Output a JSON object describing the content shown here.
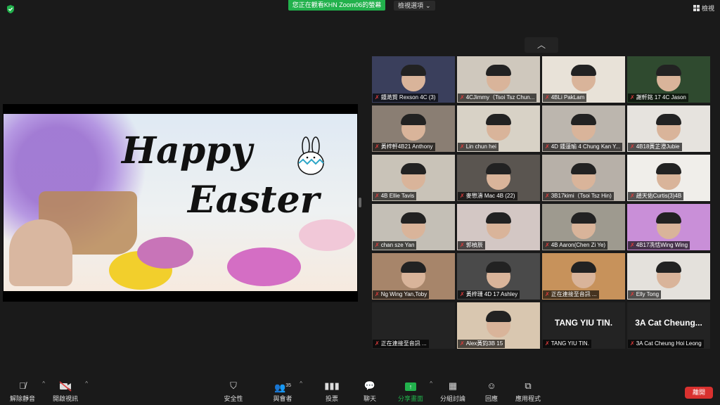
{
  "top": {
    "banner": "您正在觀看KHN Zoom06的螢幕",
    "view_options": "檢視選項",
    "view_button": "檢視"
  },
  "slide": {
    "line1": "Happy",
    "line2": "Easter"
  },
  "gallery": [
    {
      "name": "鍾澔賢 Rexson 4C (3)"
    },
    {
      "name": "4CJimmy（Tsoi Tsz Chun..."
    },
    {
      "name": "4BLi PakLam"
    },
    {
      "name": "謝軒銘 17 4C Jason"
    },
    {
      "name": "黃梓軒4B21 Anthony"
    },
    {
      "name": "Lin chun hei"
    },
    {
      "name": "4D 鍾蓮瑜 4 Chung Kan Y..."
    },
    {
      "name": "4B18黃芷澄Jubie"
    },
    {
      "name": "4B Ellie Tavis"
    },
    {
      "name": "麥懋濤 Mac 4B (22)"
    },
    {
      "name": "3B17kimi（Tsoi Tsz Hin)"
    },
    {
      "name": "趙天佑Curtis(3)4B"
    },
    {
      "name": "chan sze Yan"
    },
    {
      "name": "郭楨辰"
    },
    {
      "name": "4B Aaron(Chen Zi Ye)"
    },
    {
      "name": "4B17冼恬Wing Wing"
    },
    {
      "name": "Ng Wing Yan,Toby"
    },
    {
      "name": "黃梓珊 4D 17 Ashley"
    },
    {
      "name": "正在連接至音訊 ..."
    },
    {
      "name": "Elly Tong"
    },
    {
      "name": "正在連接至音訊 ..."
    },
    {
      "name": "Alex黃鈞3B 15"
    },
    {
      "name": "TANG YIU TIN.",
      "big": "TANG YIU TIN."
    },
    {
      "name": "3A Cat Cheung Hoi Leong",
      "big": "3A Cat Cheung..."
    }
  ],
  "toolbar": {
    "unmute": "解除靜音",
    "start_video": "開啟視訊",
    "security": "安全性",
    "participants": "與會者",
    "participants_count": "35",
    "polls": "投票",
    "chat": "聊天",
    "share": "分享畫面",
    "breakout": "分組討論",
    "reactions": "回應",
    "apps": "應用程式",
    "leave": "離開"
  },
  "colors": {
    "banner": "#22b14c",
    "leave": "#d9312f",
    "share_icon": "#22b14c",
    "mic_off": "#e03c3c"
  }
}
